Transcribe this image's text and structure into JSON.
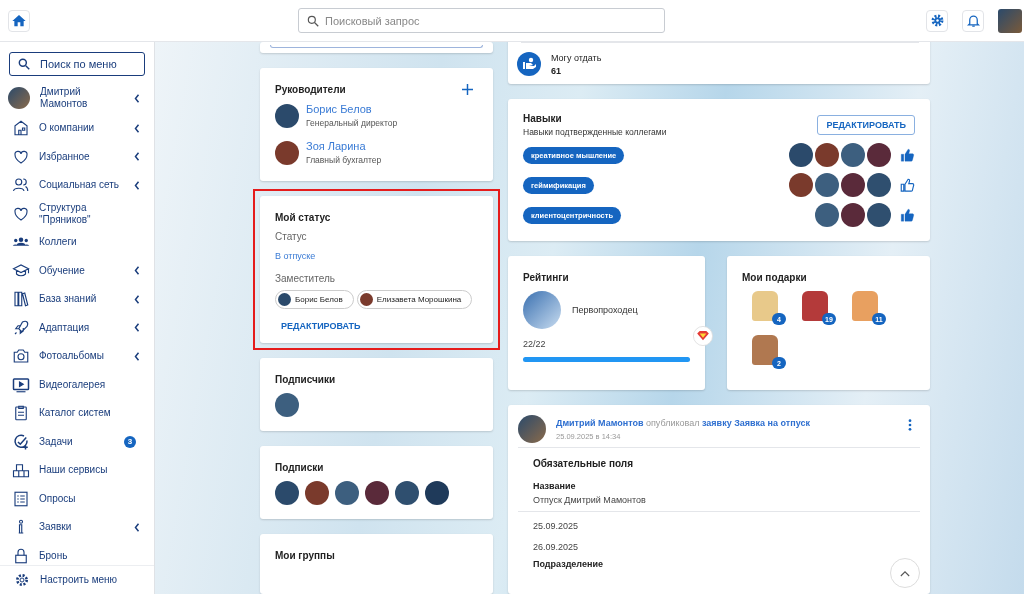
{
  "topbar": {
    "search": {
      "placeholder": "Поисковый запрос"
    }
  },
  "sidebar": {
    "search": {
      "placeholder": "Поиск по меню"
    },
    "user": {
      "name": "Дмитрий Мамонтов",
      "has_submenu": true
    },
    "items": [
      {
        "label": "О компании",
        "has_submenu": true
      },
      {
        "label": "Избранное",
        "has_submenu": true
      },
      {
        "label": "Социальная сеть",
        "has_submenu": true
      },
      {
        "label": "Структура \"Пряников\"",
        "has_submenu": false
      },
      {
        "label": "Коллеги",
        "has_submenu": false
      },
      {
        "label": "Обучение",
        "has_submenu": true
      },
      {
        "label": "База знаний",
        "has_submenu": true
      },
      {
        "label": "Адаптация",
        "has_submenu": true
      },
      {
        "label": "Фотоальбомы",
        "has_submenu": true
      },
      {
        "label": "Видеогалерея",
        "has_submenu": false
      },
      {
        "label": "Каталог систем",
        "has_submenu": false
      },
      {
        "label": "Задачи",
        "has_submenu": false,
        "badge": "3"
      },
      {
        "label": "Наши сервисы",
        "has_submenu": false
      },
      {
        "label": "Опросы",
        "has_submenu": false
      },
      {
        "label": "Заявки",
        "has_submenu": true
      },
      {
        "label": "Бронь",
        "has_submenu": false
      }
    ],
    "footer": "Настроить меню"
  },
  "managers": {
    "title": "Руководители",
    "people": [
      {
        "name": "Борис Белов",
        "role": "Генеральный директор"
      },
      {
        "name": "Зоя Ларина",
        "role": "Главный бухгалтер"
      }
    ]
  },
  "status_card": {
    "title": "Мой статус",
    "highlighted": true,
    "status_label": "Статус",
    "status": "В отпуске",
    "deputy_label": "Заместитель",
    "deputies": [
      "Борис Белов",
      "Елизавета Морошкина"
    ],
    "edit": "РЕДАКТИРОВАТЬ"
  },
  "followers": {
    "title": "Подписчики",
    "avatars": [
      {
        "kind": "photo"
      }
    ]
  },
  "subscriptions": {
    "title": "Подписки",
    "avatars": [
      {
        "kind": "photo"
      },
      {
        "kind": "photo"
      },
      {
        "kind": "photo"
      },
      {
        "kind": "photo"
      },
      {
        "kind": "photo"
      },
      {
        "kind": "photo"
      }
    ]
  },
  "groups": {
    "title": "Мои группы"
  },
  "give": {
    "label": "Могу отдать",
    "value": "61"
  },
  "skills": {
    "title": "Навыки",
    "subtitle": "Навыки подтвержденные коллегами",
    "edit": "РЕДАКТИРОВАТЬ",
    "items": [
      {
        "name": "креативное мышление",
        "liked": true,
        "endorsers": [
          {
            "kind": "photo"
          },
          {
            "kind": "photo"
          },
          {
            "kind": "photo"
          },
          {
            "kind": "photo"
          }
        ]
      },
      {
        "name": "геймификация",
        "liked": false,
        "endorsers": [
          {
            "kind": "photo"
          },
          {
            "kind": "photo"
          },
          {
            "kind": "photo"
          },
          {
            "kind": "photo"
          }
        ]
      },
      {
        "name": "клиентоцентричность",
        "liked": true,
        "endorsers": [
          {
            "kind": "photo"
          },
          {
            "kind": "photo"
          },
          {
            "kind": "photo"
          }
        ]
      }
    ]
  },
  "ratings": {
    "title": "Рейтинги",
    "name": "Первопроходец",
    "progress": "22/22",
    "level": 1.0
  },
  "gifts": {
    "title": "Мои подарки",
    "items": [
      {
        "count": "4"
      },
      {
        "count": "19"
      },
      {
        "count": "11"
      },
      {
        "count": "2"
      }
    ]
  },
  "post": {
    "author": "Дмитрий Мамонтов",
    "action": "опубликовал",
    "link": "заявку Заявка на отпуск",
    "date": "25.09.2025 в 14:34",
    "section": "Обязательные поля",
    "field_label": "Название",
    "field_value": "Отпуск Дмитрий Мамонтов",
    "dates": [
      "25.09.2025",
      "26.09.2025"
    ],
    "next_label": "Подразделение"
  }
}
